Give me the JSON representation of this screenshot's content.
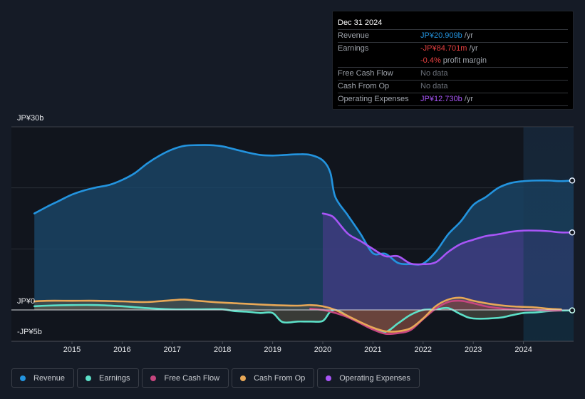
{
  "tooltip": {
    "date": "Dec 31 2024",
    "rows": [
      {
        "label": "Revenue",
        "value": "JP¥20.909b",
        "suffix": " /yr"
      },
      {
        "label": "Earnings",
        "value": "-JP¥84.701m",
        "suffix": " /yr"
      },
      {
        "label": "",
        "value": "-0.4%",
        "suffix": " profit margin"
      },
      {
        "label": "Free Cash Flow",
        "value": "No data",
        "suffix": ""
      },
      {
        "label": "Cash From Op",
        "value": "No data",
        "suffix": ""
      },
      {
        "label": "Operating Expenses",
        "value": "JP¥12.730b",
        "suffix": " /yr"
      }
    ]
  },
  "legend": [
    {
      "label": "Revenue",
      "color": "#2394df"
    },
    {
      "label": "Earnings",
      "color": "#5ce0c8"
    },
    {
      "label": "Free Cash Flow",
      "color": "#c6467f"
    },
    {
      "label": "Cash From Op",
      "color": "#e8a857"
    },
    {
      "label": "Operating Expenses",
      "color": "#a855f7"
    }
  ],
  "chart_data": {
    "type": "area",
    "title": "",
    "ylabel": "",
    "ylim": [
      -5,
      30
    ],
    "y_tick_labels": [
      "JP¥30b",
      "JP¥0",
      "-JP¥5b"
    ],
    "y_ticks": [
      30,
      0,
      -5
    ],
    "gridlines": [
      20,
      10
    ],
    "xlim": [
      2014.0,
      2025.0
    ],
    "x_ticks": [
      2015,
      2016,
      2017,
      2018,
      2019,
      2020,
      2021,
      2022,
      2023,
      2024
    ],
    "x_tick_labels": [
      "2015",
      "2016",
      "2017",
      "2018",
      "2019",
      "2020",
      "2021",
      "2022",
      "2023",
      "2024"
    ],
    "highlight_start": 2024.0,
    "units": "JP¥ billions",
    "series": [
      {
        "name": "Revenue",
        "color": "#2394df",
        "x": [
          2014.25,
          2014.5,
          2014.75,
          2015.0,
          2015.25,
          2015.5,
          2015.75,
          2016.0,
          2016.25,
          2016.5,
          2016.75,
          2017.0,
          2017.25,
          2017.5,
          2017.75,
          2018.0,
          2018.25,
          2018.5,
          2018.75,
          2019.0,
          2019.25,
          2019.5,
          2019.75,
          2020.0,
          2020.15,
          2020.25,
          2020.5,
          2020.75,
          2021.0,
          2021.25,
          2021.5,
          2021.75,
          2022.0,
          2022.25,
          2022.5,
          2022.75,
          2023.0,
          2023.25,
          2023.5,
          2023.75,
          2024.0,
          2024.25,
          2024.5,
          2024.75,
          2025.0
        ],
        "values": [
          15.8,
          16.9,
          17.9,
          18.9,
          19.6,
          20.1,
          20.5,
          21.3,
          22.4,
          24.0,
          25.3,
          26.3,
          26.9,
          27.0,
          27.0,
          26.8,
          26.3,
          25.8,
          25.4,
          25.3,
          25.4,
          25.5,
          25.4,
          24.5,
          22.5,
          18.5,
          15.5,
          12.5,
          9.3,
          9.2,
          7.7,
          7.5,
          7.6,
          9.5,
          12.4,
          14.5,
          17.2,
          18.5,
          20.0,
          20.8,
          21.1,
          21.2,
          21.2,
          21.1,
          21.2
        ]
      },
      {
        "name": "Operating Expenses",
        "color": "#a855f7",
        "x": [
          2020.0,
          2020.15,
          2020.25,
          2020.5,
          2020.75,
          2021.0,
          2021.25,
          2021.5,
          2021.75,
          2022.0,
          2022.25,
          2022.5,
          2022.75,
          2023.0,
          2023.25,
          2023.5,
          2023.75,
          2024.0,
          2024.25,
          2024.5,
          2024.75,
          2025.0
        ],
        "values": [
          15.8,
          15.5,
          14.9,
          12.5,
          11.3,
          10.0,
          8.8,
          8.8,
          7.6,
          7.5,
          7.8,
          9.5,
          10.8,
          11.5,
          12.1,
          12.4,
          12.8,
          13.0,
          13.0,
          12.9,
          12.7,
          12.7
        ]
      },
      {
        "name": "Earnings",
        "color": "#5ce0c8",
        "x": [
          2014.25,
          2014.5,
          2015.0,
          2015.5,
          2016.0,
          2016.5,
          2017.0,
          2017.5,
          2018.0,
          2018.25,
          2018.5,
          2018.75,
          2019.0,
          2019.2,
          2019.5,
          2019.75,
          2020.0,
          2020.15,
          2020.3,
          2020.6,
          2021.0,
          2021.25,
          2021.5,
          2021.75,
          2022.0,
          2022.25,
          2022.5,
          2022.75,
          2023.0,
          2023.5,
          2023.75,
          2024.0,
          2024.25,
          2024.5,
          2024.75,
          2025.0
        ],
        "values": [
          0.6,
          0.7,
          0.8,
          0.8,
          0.6,
          0.3,
          0.1,
          0.1,
          0.1,
          -0.2,
          -0.3,
          -0.5,
          -0.5,
          -2.0,
          -1.9,
          -1.9,
          -1.8,
          -0.3,
          -0.1,
          -1.5,
          -3.0,
          -3.6,
          -2.2,
          -0.8,
          0.0,
          0.1,
          0.3,
          -0.7,
          -1.4,
          -1.3,
          -0.9,
          -0.5,
          -0.4,
          -0.2,
          -0.1,
          -0.08
        ]
      },
      {
        "name": "Free Cash Flow",
        "color": "#c6467f",
        "x": [
          2019.75,
          2020.0,
          2020.25,
          2020.5,
          2020.75,
          2021.0,
          2021.25,
          2021.5,
          2021.75,
          2022.0,
          2022.25,
          2022.5,
          2022.75,
          2023.0,
          2023.25,
          2023.5,
          2023.75,
          2024.0,
          2024.25,
          2024.5,
          2024.75
        ],
        "values": [
          0.2,
          0.0,
          -0.5,
          -1.2,
          -2.2,
          -3.2,
          -3.9,
          -3.8,
          -3.3,
          -1.5,
          0.2,
          1.3,
          1.5,
          1.1,
          0.6,
          0.3,
          0.1,
          0.0,
          0.0,
          -0.1,
          -0.1
        ]
      },
      {
        "name": "Cash From Op",
        "color": "#e8a857",
        "x": [
          2014.25,
          2014.5,
          2015.0,
          2015.5,
          2016.0,
          2016.5,
          2017.0,
          2017.25,
          2017.5,
          2018.0,
          2018.5,
          2019.0,
          2019.5,
          2019.75,
          2020.0,
          2020.25,
          2020.5,
          2020.75,
          2021.0,
          2021.25,
          2021.5,
          2021.75,
          2022.0,
          2022.25,
          2022.5,
          2022.75,
          2023.0,
          2023.25,
          2023.5,
          2023.75,
          2024.0,
          2024.25,
          2024.5,
          2024.75
        ],
        "values": [
          1.4,
          1.5,
          1.5,
          1.5,
          1.4,
          1.3,
          1.6,
          1.7,
          1.5,
          1.2,
          1.0,
          0.8,
          0.7,
          0.8,
          0.6,
          0.0,
          -1.0,
          -2.0,
          -2.9,
          -3.5,
          -3.5,
          -3.0,
          -1.4,
          0.6,
          1.7,
          2.0,
          1.5,
          1.1,
          0.8,
          0.6,
          0.5,
          0.4,
          0.2,
          0.1
        ]
      }
    ]
  }
}
